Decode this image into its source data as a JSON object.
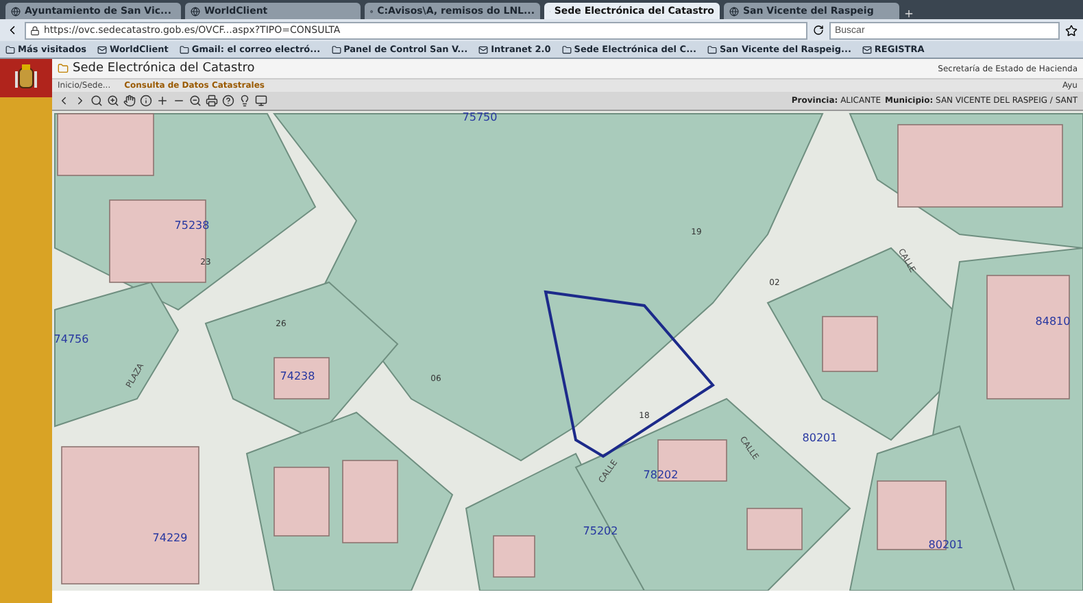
{
  "browser": {
    "tabs": [
      {
        "label": "Ayuntamiento de San Vic...",
        "selected": false
      },
      {
        "label": "WorldClient",
        "selected": false
      },
      {
        "label": "C:Avisos\\A, remisos do LNL...",
        "selected": false
      },
      {
        "label": "Sede Electrónica del Catastro",
        "selected": true
      },
      {
        "label": "San Vicente del Raspeig",
        "selected": false
      }
    ],
    "url": "https://ovc.sedecatastro.gob.es/OVCF...aspx?TIPO=CONSULTA",
    "search": {
      "placeholder": "Buscar"
    },
    "bookmarks": [
      "Más visitados",
      "WorldClient",
      "Gmail: el correo electró...",
      "Panel de Control San V...",
      "Intranet 2.0",
      "Sede Electrónica del C...",
      "San Vicente del Raspeig...",
      "REGISTRA"
    ]
  },
  "site": {
    "title": "Sede Electrónica del Catastro",
    "ministry": "Secretaría de Estado de Hacienda",
    "breadcrumb": [
      "Inicio/Sede...",
      "Consulta de Datos Catastrales"
    ],
    "aside": "Ayu",
    "location": [
      {
        "label": "Provincia:",
        "value": "ALICANTE"
      },
      {
        "label": "Municipio:",
        "value": "SAN VICENTE DEL RASPEIG / SANT"
      }
    ]
  },
  "map_labels": [
    {
      "text": "75750",
      "kind": "block"
    },
    {
      "text": "75238",
      "kind": "block"
    },
    {
      "text": "74238",
      "kind": "block"
    },
    {
      "text": "74229",
      "kind": "block"
    },
    {
      "text": "75202",
      "kind": "block"
    },
    {
      "text": "78202",
      "kind": "block"
    },
    {
      "text": "80201",
      "kind": "block"
    },
    {
      "text": "80201",
      "kind": "block"
    },
    {
      "text": "74756",
      "kind": "block"
    },
    {
      "text": "84810",
      "kind": "block"
    },
    {
      "text": "23",
      "kind": "parcel"
    },
    {
      "text": "26",
      "kind": "parcel"
    },
    {
      "text": "06",
      "kind": "parcel"
    },
    {
      "text": "19",
      "kind": "parcel"
    },
    {
      "text": "02",
      "kind": "parcel"
    },
    {
      "text": "18",
      "kind": "parcel"
    },
    {
      "text": "PLAZA",
      "kind": "street"
    },
    {
      "text": "CALLE",
      "kind": "street"
    },
    {
      "text": "CALLE",
      "kind": "street"
    },
    {
      "text": "CALLE",
      "kind": "street"
    }
  ]
}
